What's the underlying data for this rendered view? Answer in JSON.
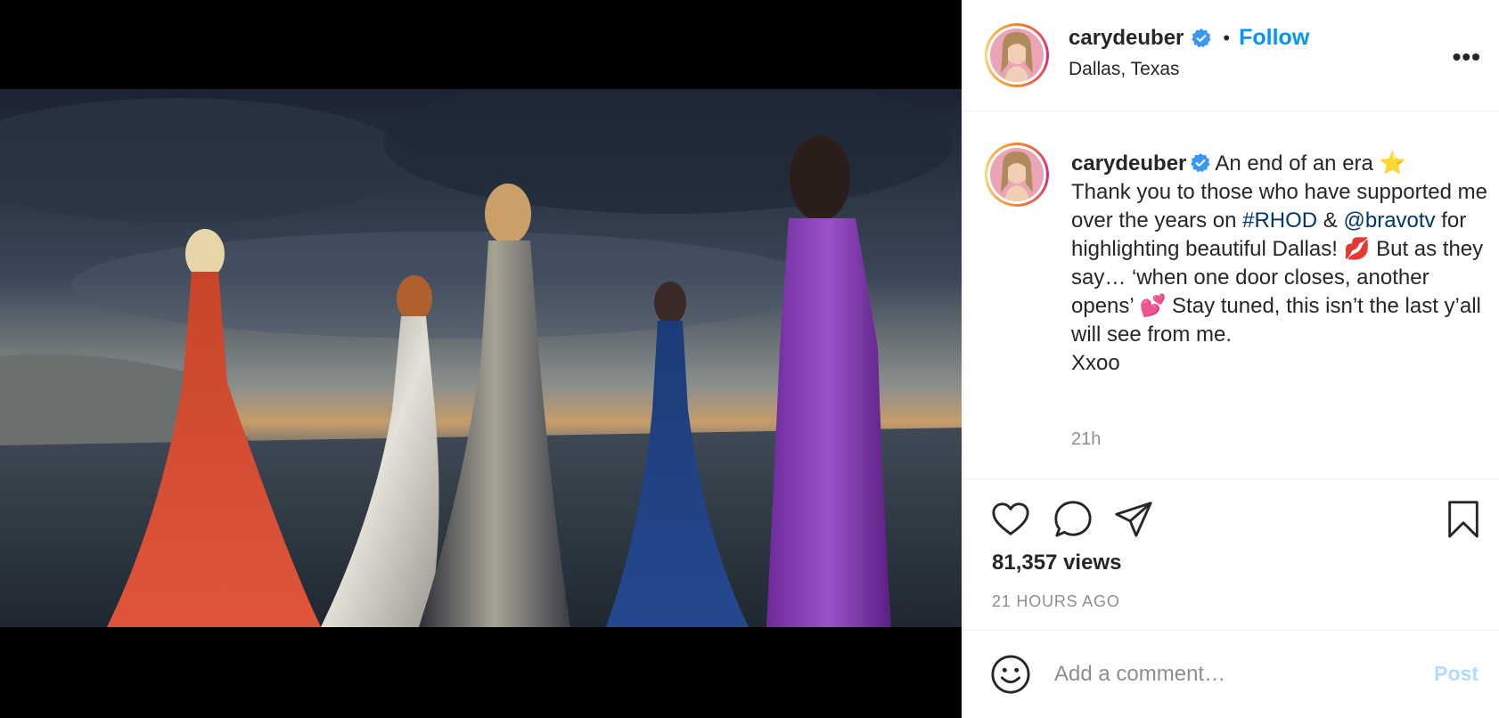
{
  "post": {
    "username": "carydeuber",
    "location": "Dallas, Texas",
    "follow_label": "Follow",
    "separator": "•",
    "more_label": "•••",
    "caption": {
      "username": "carydeuber",
      "line1": "An end of an era ⭐",
      "line2": "Thank you to those who have supported me over the years on",
      "hashtag": "#RHOD",
      "amp": "&",
      "mention": "@bravotv",
      "line3": "for highlighting beautiful Dallas! 💋 But as they say… ‘when one door closes, another opens’ 💕 Stay tuned, this isn’t the last y’all will see from me.",
      "line4": "Xxoo"
    },
    "caption_time": "21h",
    "views": "81,357 views",
    "posted_ago": "21 HOURS AGO"
  },
  "comment": {
    "placeholder": "Add a comment…",
    "post_label": "Post"
  },
  "icons": {
    "verified": "verified-badge-icon",
    "like": "heart-icon",
    "comment": "comment-bubble-icon",
    "share": "paper-plane-icon",
    "save": "bookmark-icon",
    "emoji": "smiley-icon",
    "tag": "person-icon",
    "mute": "speaker-muted-icon"
  },
  "colors": {
    "accent": "#0095f6",
    "verified": "#3897f0",
    "link": "#00376b",
    "muted_text": "#8e8e8e",
    "post_disabled": "#b3dbff"
  }
}
